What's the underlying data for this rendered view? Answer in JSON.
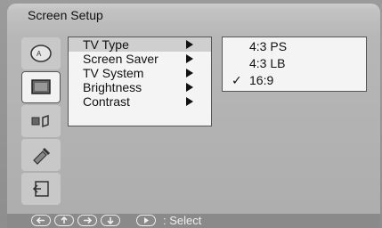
{
  "title": "Screen Setup",
  "icons": [
    {
      "name": "language-icon",
      "selected": false
    },
    {
      "name": "tv-icon",
      "selected": true
    },
    {
      "name": "audio-icon",
      "selected": false
    },
    {
      "name": "tools-icon",
      "selected": false
    },
    {
      "name": "exit-icon",
      "selected": false
    }
  ],
  "menu": [
    {
      "label": "TV Type",
      "highlight": true
    },
    {
      "label": "Screen Saver",
      "highlight": false
    },
    {
      "label": "TV System",
      "highlight": false
    },
    {
      "label": "Brightness",
      "highlight": false
    },
    {
      "label": "Contrast",
      "highlight": false
    }
  ],
  "submenu": [
    {
      "label": "4:3 PS",
      "checked": false
    },
    {
      "label": "4:3 LB",
      "checked": false
    },
    {
      "label": "16:9",
      "checked": true
    }
  ],
  "footer": {
    "select_label": ": Select",
    "keys": [
      "left",
      "up",
      "right",
      "down",
      "play"
    ]
  }
}
